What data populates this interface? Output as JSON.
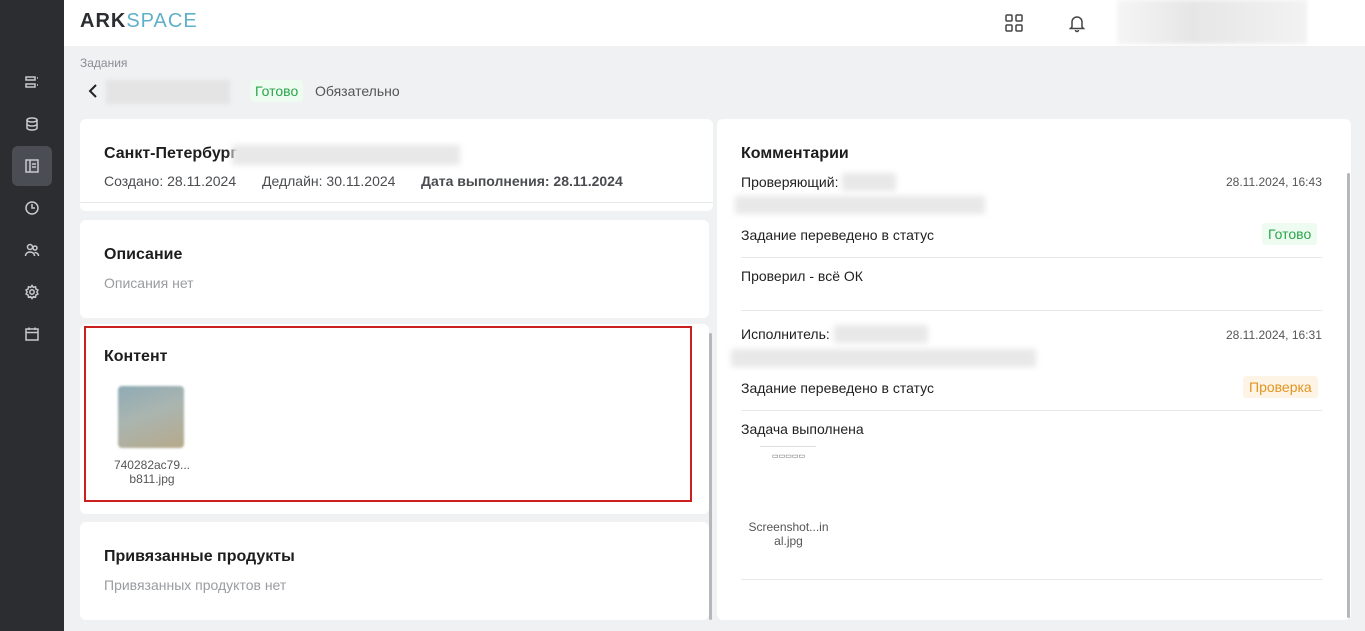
{
  "app": {
    "logo_part1": "ARK",
    "logo_part2": "SPACE"
  },
  "rail": {
    "items": [
      {
        "icon": "list-icon"
      },
      {
        "icon": "database-icon"
      },
      {
        "icon": "tasks-panel-icon",
        "active": true
      },
      {
        "icon": "clock-icon"
      },
      {
        "icon": "users-icon"
      },
      {
        "icon": "gear-icon"
      },
      {
        "icon": "calendar-icon"
      }
    ]
  },
  "header": {
    "breadcrumb": "Задания",
    "status": "Готово",
    "requirement": "Обязательно"
  },
  "task": {
    "city": "Санкт-Петербург",
    "created": "Создано: 28.11.2024",
    "deadline": "Дедлайн: 30.11.2024",
    "completed": "Дата выполнения: 28.11.2024"
  },
  "description": {
    "title": "Описание",
    "empty": "Описания нет"
  },
  "content": {
    "title": "Контент",
    "file_line1": "740282ac79...",
    "file_line2": "b811.jpg"
  },
  "products": {
    "title": "Привязанные продукты",
    "empty": "Привязанных продуктов нет"
  },
  "comments": {
    "title": "Комментарии",
    "entries": [
      {
        "role": "Проверяющий:",
        "time": "28.11.2024, 16:43",
        "status_text": "Задание переведено в статус",
        "status": "Готово",
        "message": "Проверил - всё ОК"
      },
      {
        "role": "Исполнитель:",
        "time": "28.11.2024, 16:31",
        "status_text": "Задание переведено в статус",
        "status": "Проверка",
        "message": "Задача выполнена",
        "file_line1": "Screenshot...in",
        "file_line2": "al.jpg"
      }
    ]
  },
  "colors": {
    "rail_bg": "#2b2d31",
    "status_green": "#2aa64a",
    "status_orange": "#e39520",
    "highlight_red": "#cc1f1f",
    "logo_accent": "#5fb0c9"
  }
}
